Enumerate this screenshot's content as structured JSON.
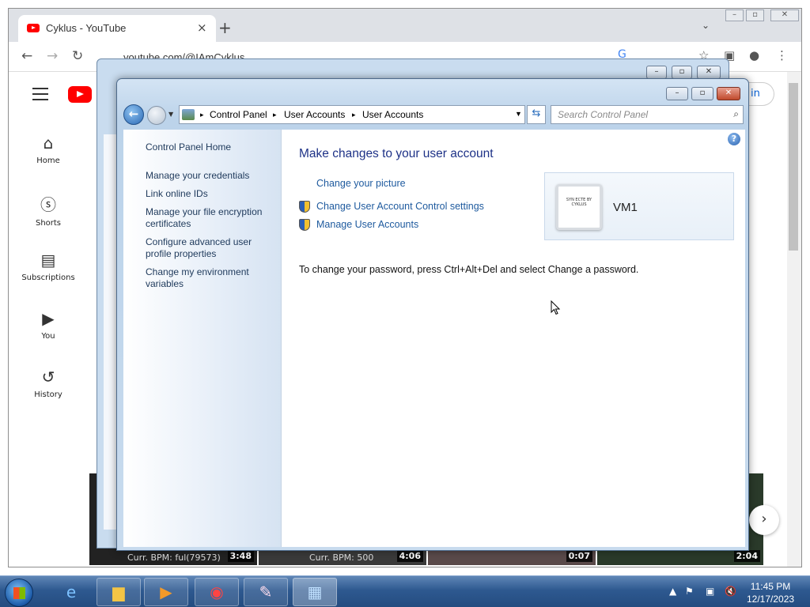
{
  "browser": {
    "tab_title": "Cyklus - YouTube",
    "tab_close": "×",
    "new_tab": "+",
    "tab_menu": "⌄",
    "url": "youtube.com/@IAmCyklus",
    "window_controls": {
      "minimize": "–",
      "restore": "▫",
      "close": "✕"
    }
  },
  "youtube": {
    "sidebar": [
      {
        "label": "Home",
        "icon": "⌂"
      },
      {
        "label": "Shorts",
        "icon": "ⓢ"
      },
      {
        "label": "Subscriptions",
        "icon": "▤"
      },
      {
        "label": "You",
        "icon": "▶"
      },
      {
        "label": "History",
        "icon": "↺"
      }
    ],
    "sign_in": "in",
    "videos": [
      {
        "bpm": "Curr. BPM: ful(79573)",
        "duration": "3:48"
      },
      {
        "bpm": "Curr. BPM: 500",
        "duration": "4:06"
      },
      {
        "bpm": "",
        "duration": "0:07"
      },
      {
        "bpm": "",
        "duration": "2:04"
      }
    ],
    "next": "›"
  },
  "control_panel": {
    "breadcrumbs": [
      "Control Panel",
      "User Accounts",
      "User Accounts"
    ],
    "search_placeholder": "Search Control Panel",
    "sidebar_links": [
      "Control Panel Home",
      "Manage your credentials",
      "Link online IDs",
      "Manage your file encryption certificates",
      "Configure advanced user profile properties",
      "Change my environment variables"
    ],
    "heading": "Make changes to your user account",
    "links": [
      "Change your picture",
      "Change User Account Control settings",
      "Manage User Accounts"
    ],
    "account_name": "VM1",
    "avatar_text": "SYN ECTE BY CYKLUS",
    "password_note": "To change your password, press Ctrl+Alt+Del and select Change a password."
  },
  "taskbar": {
    "time": "11:45 PM",
    "date": "12/17/2023"
  }
}
